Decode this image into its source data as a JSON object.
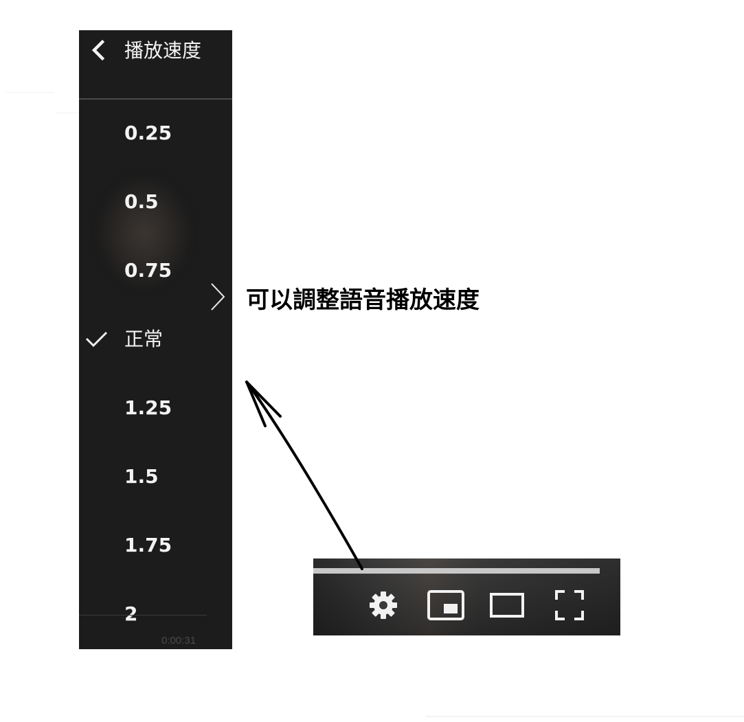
{
  "speed_menu": {
    "title": "播放速度",
    "back_icon": "chevron-left-icon",
    "check_icon": "checkmark-icon",
    "selected_label": "正常",
    "items": [
      {
        "label": "0.25",
        "selected": false
      },
      {
        "label": "0.5",
        "selected": false
      },
      {
        "label": "0.75",
        "selected": false
      },
      {
        "label": "正常",
        "selected": true
      },
      {
        "label": "1.25",
        "selected": false
      },
      {
        "label": "1.5",
        "selected": false
      },
      {
        "label": "1.75",
        "selected": false
      },
      {
        "label": "2",
        "selected": false
      }
    ],
    "timestamp": "0:00:31"
  },
  "annotation": {
    "text": "可以調整語音播放速度",
    "arrow_icon": "hand-drawn-arrow-icon",
    "color": "#000000"
  },
  "player_controls": {
    "icons": [
      "gear-icon",
      "miniplayer-icon",
      "theater-mode-icon",
      "fullscreen-icon"
    ]
  },
  "colors": {
    "panel_background": "#1c1c1c",
    "panel_text": "#f1f1f1",
    "page_background": "#ffffff",
    "progress_track": "#c8c8c8"
  }
}
